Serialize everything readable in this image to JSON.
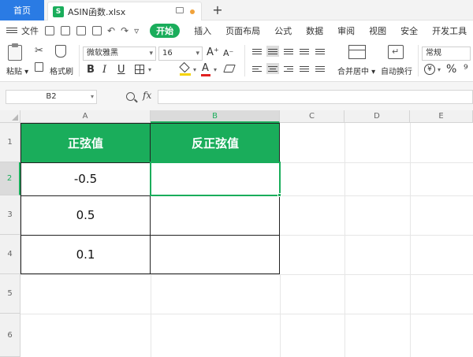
{
  "tabs": {
    "home_label": "首页",
    "file_badge": "S",
    "file_name": "ASIN函数.xlsx",
    "new_tab_symbol": "+"
  },
  "menu": {
    "file_label": "文件",
    "start_label": "开始",
    "items": [
      "插入",
      "页面布局",
      "公式",
      "数据",
      "审阅",
      "视图",
      "安全",
      "开发工具"
    ]
  },
  "ribbon": {
    "paste_label": "粘贴",
    "format_painter_label": "格式刷",
    "font_name": "微软雅黑",
    "font_size": "16",
    "bold": "B",
    "italic": "I",
    "underline": "U",
    "font_color_glyph": "A",
    "grow_font": "A⁺",
    "shrink_font": "A⁻",
    "merge_label": "合并居中",
    "wrap_label": "自动换行",
    "number_format": "常规",
    "currency_glyph": "¥",
    "percent_glyph": "%",
    "comma_glyph": "⁹"
  },
  "formula_bar": {
    "cell_ref": "B2",
    "fx_label": "fx",
    "content": ""
  },
  "grid": {
    "columns": [
      "A",
      "B",
      "C",
      "D",
      "E"
    ],
    "rows": [
      "1",
      "2",
      "3",
      "4",
      "5",
      "6"
    ],
    "active_column": "B",
    "active_row": "2",
    "header_fill": "#1aad5b",
    "selection_color": "#1aad5b"
  },
  "table": {
    "headers": [
      "正弦值",
      "反正弦值"
    ],
    "rows": [
      [
        "-0.5",
        ""
      ],
      [
        "0.5",
        ""
      ],
      [
        "0.1",
        ""
      ]
    ]
  }
}
